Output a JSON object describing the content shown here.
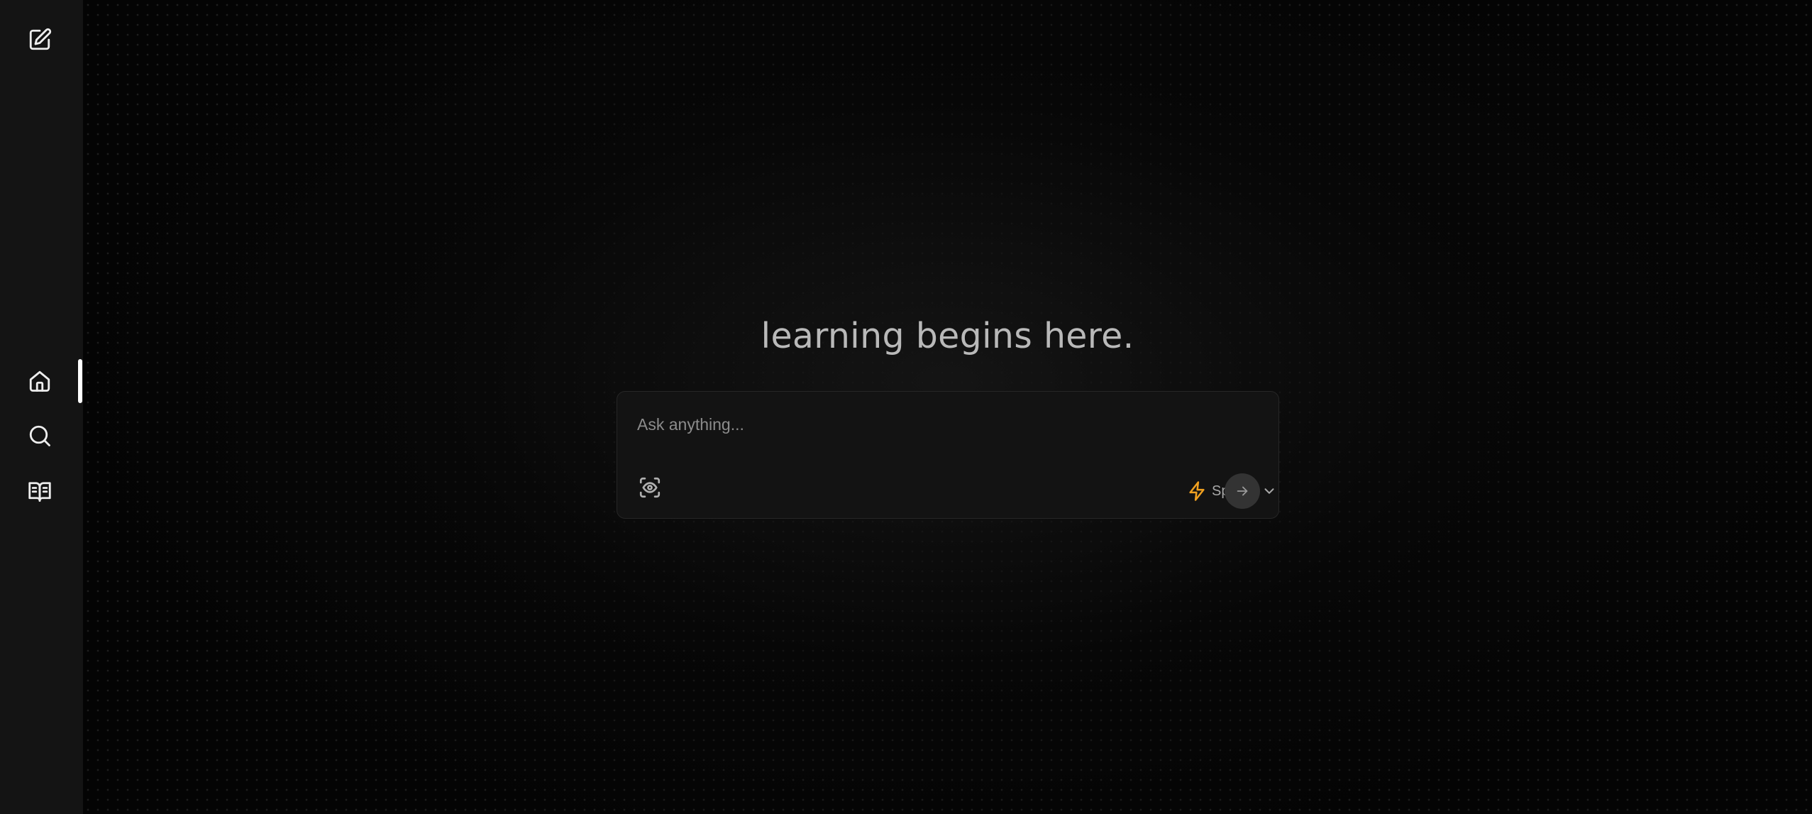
{
  "sidebar": {
    "new_chat_icon": "edit-icon",
    "items": [
      {
        "id": "home",
        "icon": "home-icon",
        "active": true
      },
      {
        "id": "search",
        "icon": "search-icon",
        "active": false
      },
      {
        "id": "library",
        "icon": "book-open-icon",
        "active": false
      }
    ]
  },
  "main": {
    "headline": "learning begins here.",
    "prompt": {
      "placeholder": "Ask anything...",
      "value": "",
      "vision_icon": "scan-eye-icon",
      "mode": {
        "label": "Speed",
        "icon": "lightning-icon",
        "icon_color": "#f0a020"
      },
      "send_icon": "arrow-right-icon"
    }
  },
  "colors": {
    "sidebar_bg": "#141414",
    "page_bg": "#040404",
    "accent": "#f0a020",
    "active_indicator": "#ffffff"
  }
}
